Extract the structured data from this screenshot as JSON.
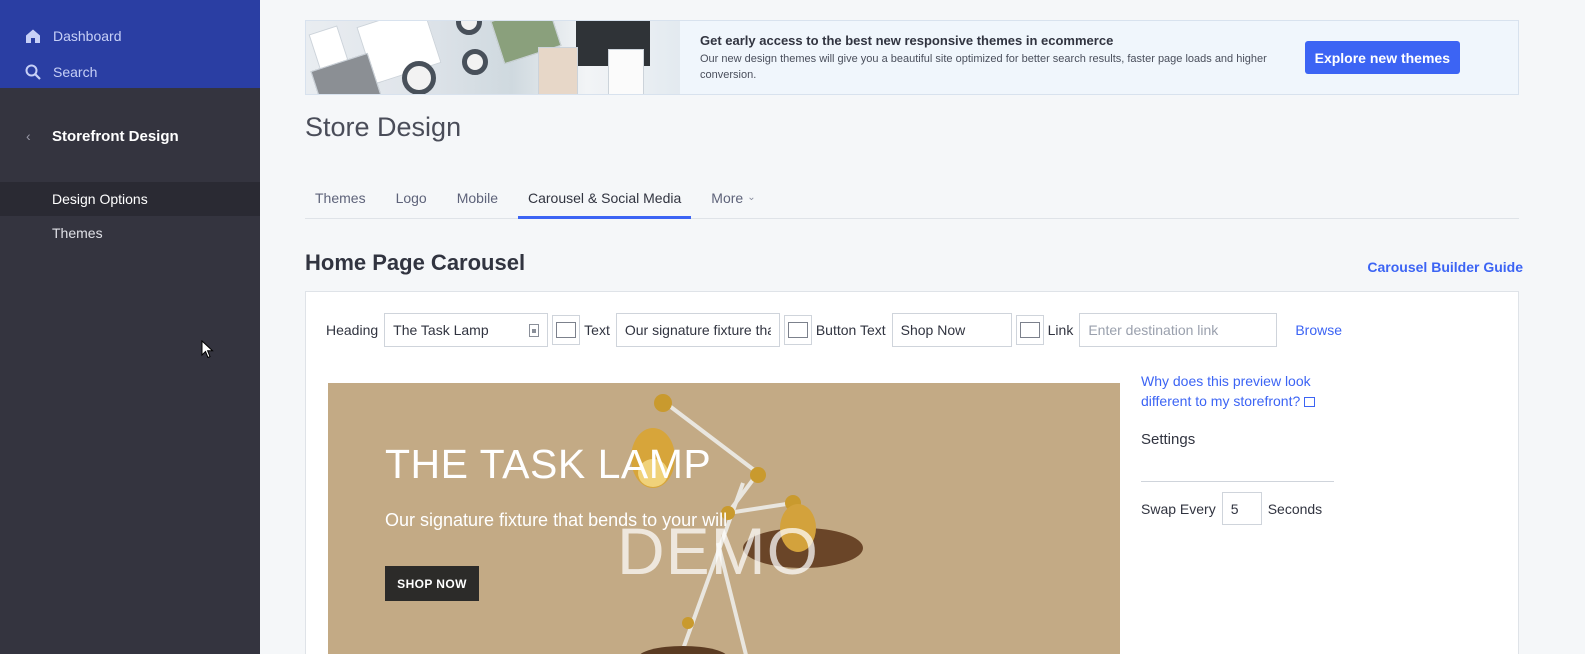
{
  "sidebar": {
    "top_items": [
      {
        "label": "Dashboard",
        "icon": "home-icon"
      },
      {
        "label": "Search",
        "icon": "search-icon"
      }
    ],
    "section_title": "Storefront Design",
    "items": [
      {
        "label": "Design Options",
        "active": true
      },
      {
        "label": "Themes",
        "active": false
      }
    ]
  },
  "banner": {
    "title": "Get early access to the best new responsive themes in ecommerce",
    "subtitle": "Our new design themes will give you a beautiful site optimized for better search results, faster page loads and higher conversion.",
    "button_label": "Explore new themes"
  },
  "page_title": "Store Design",
  "tabs": [
    {
      "label": "Themes",
      "active": false
    },
    {
      "label": "Logo",
      "active": false
    },
    {
      "label": "Mobile",
      "active": false
    },
    {
      "label": "Carousel & Social Media",
      "active": true
    },
    {
      "label": "More",
      "active": false,
      "dropdown": true
    }
  ],
  "carousel": {
    "section_title": "Home Page Carousel",
    "guide_link": "Carousel Builder Guide",
    "fields": {
      "heading_label": "Heading",
      "heading_value": "The Task Lamp",
      "text_label": "Text",
      "text_value": "Our signature fixture tha",
      "button_text_label": "Button Text",
      "button_text_value": "Shop Now",
      "link_label": "Link",
      "link_placeholder": "Enter destination link",
      "browse_label": "Browse"
    },
    "preview": {
      "title": "THE TASK LAMP",
      "subtitle": "Our signature fixture that bends to your will",
      "button": "SHOP NOW",
      "watermark": "DEMO",
      "background_color": "#c3aa85"
    },
    "side": {
      "why_link": "Why does this preview look different to my storefront?",
      "settings_label": "Settings",
      "swap_every_label": "Swap Every",
      "swap_value": "5",
      "seconds_label": "Seconds"
    }
  },
  "colors": {
    "accent": "#3c64f4",
    "sidebar_bg": "#34343f",
    "sidebar_top_bg": "#2a3ea3"
  }
}
